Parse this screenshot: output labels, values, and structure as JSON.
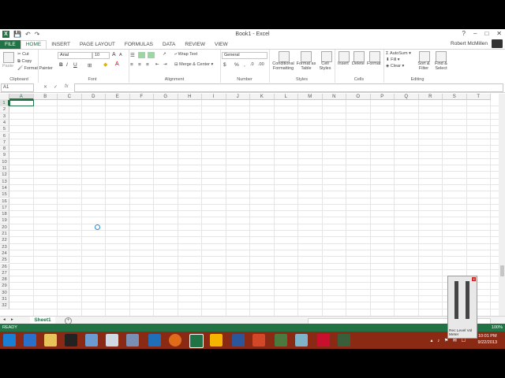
{
  "window": {
    "title": "Book1 - Excel",
    "min": "?",
    "restore": "□",
    "close": "✕",
    "help": "?"
  },
  "qat": {
    "save": "💾",
    "undo": "↶",
    "redo": "↷"
  },
  "tabs": [
    "FILE",
    "HOME",
    "INSERT",
    "PAGE LAYOUT",
    "FORMULAS",
    "DATA",
    "REVIEW",
    "VIEW"
  ],
  "user": "Robert McMillen",
  "ribbon": {
    "clipboard": {
      "label": "Clipboard",
      "paste": "Paste",
      "cut": "Cut",
      "copy": "Copy",
      "painter": "Format Painter"
    },
    "font": {
      "label": "Font",
      "name": "Arial",
      "size": "10",
      "grow": "A",
      "shrink": "A",
      "bold": "B",
      "italic": "I",
      "underline": "U"
    },
    "alignment": {
      "label": "Alignment",
      "wrap": "Wrap Text",
      "merge": "Merge & Center"
    },
    "number": {
      "label": "Number",
      "format": "General",
      "currency": "$",
      "percent": "%",
      "comma": ","
    },
    "styles": {
      "label": "Styles",
      "conditional": "Conditional Formatting",
      "table": "Format as Table",
      "cell": "Cell Styles"
    },
    "cells": {
      "label": "Cells",
      "insert": "Insert",
      "delete": "Delete",
      "format": "Format"
    },
    "editing": {
      "label": "Editing",
      "autosum": "AutoSum",
      "fill": "Fill",
      "clear": "Clear",
      "sort": "Sort & Filter",
      "find": "Find & Select"
    }
  },
  "formula_bar": {
    "namebox": "A1",
    "fx": "fx",
    "cancel": "✕",
    "enter": "✓"
  },
  "columns": [
    "A",
    "B",
    "C",
    "D",
    "E",
    "F",
    "G",
    "H",
    "I",
    "J",
    "K",
    "L",
    "M",
    "N",
    "O",
    "P",
    "Q",
    "R",
    "S",
    "T"
  ],
  "rows": [
    "1",
    "2",
    "3",
    "4",
    "5",
    "6",
    "7",
    "8",
    "9",
    "10",
    "11",
    "12",
    "13",
    "14",
    "15",
    "16",
    "17",
    "18",
    "19",
    "20",
    "21",
    "22",
    "23",
    "24",
    "25",
    "26",
    "27",
    "28",
    "29",
    "30",
    "31",
    "32"
  ],
  "sheet": {
    "tab": "Sheet1",
    "add": "+"
  },
  "status": {
    "ready": "READY",
    "zoom": "100%"
  },
  "meter": {
    "label": "Rec Level Vol Meter"
  },
  "clock": {
    "time": "10:01 PM",
    "date": "9/22/2013"
  },
  "colors": {
    "accent": "#217346",
    "taskbar": "#8a2a14"
  }
}
